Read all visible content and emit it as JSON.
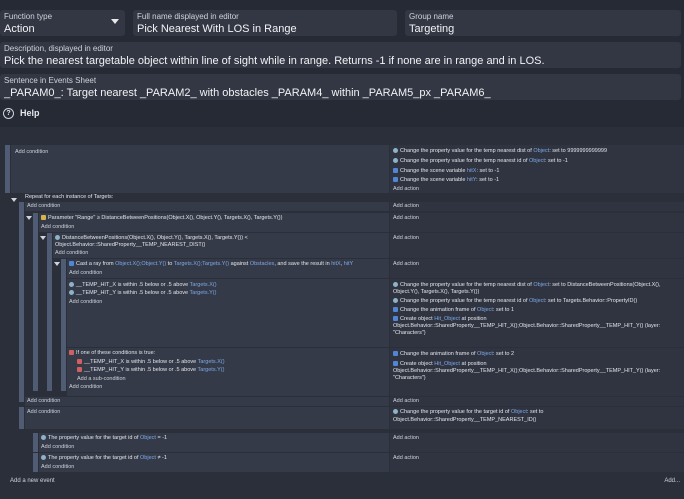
{
  "fields": {
    "function_type": {
      "label": "Function type",
      "value": "Action"
    },
    "full_name": {
      "label": "Full name displayed in editor",
      "value": "Pick Nearest With LOS in Range"
    },
    "group_name": {
      "label": "Group name",
      "value": "Targeting"
    },
    "description": {
      "label": "Description, displayed in editor",
      "value": "Pick the nearest targetable object within line of sight while in range. Returns -1 if none are in range and in LOS."
    },
    "sentence": {
      "label": "Sentence in Events Sheet",
      "value": "_PARAM0_: Target nearest _PARAM2_ with obstacles _PARAM4_ within _PARAM5_px        _PARAM6_"
    }
  },
  "help_label": "Help",
  "add_condition": "Add condition",
  "add_action": "Add action",
  "add_subcondition": "Add a sub-condition",
  "add_new_event": "Add a new event",
  "add_more": "Add...",
  "events": {
    "e1_actions": [
      {
        "text": "Change the property value for the temp nearest dist of ",
        "obj": "Object",
        "rest": ": set to  9999999999999"
      },
      {
        "text": "Change the property value for the temp nearest id of ",
        "obj": "Object",
        "rest": ": set to  -1"
      },
      {
        "text": "Change the scene variable ",
        "obj": "hitX",
        "rest": ": set to  -1"
      },
      {
        "text": "Change the scene variable ",
        "obj": "hitY",
        "rest": ": set to  -1"
      }
    ],
    "repeat_label": "Repeat for each instance of Targets:",
    "param_cond": "Parameter \"Range\"  ≥  DistanceBetweenPositions(Object.X(), Object.Y(), Targets.X(), Targets.Y())",
    "dist_cond1": "DistanceBetweenPositions(Object.X(), Object.Y(), Targets.X(), Targets.Y())  <",
    "dist_cond2": "Object.Behavior::SharedProperty__TEMP_NEAREST_DIST()",
    "raycast": {
      "a": "Cast a ray from ",
      "b": "Object.X();Object.Y()",
      "c": " to ",
      "d": "Targets.X();Targets.Y()",
      "e": " against ",
      "f": "Obstacles",
      "g": ", and save the result in ",
      "h": "hitX",
      ",": ", ",
      "i": "hitY"
    },
    "hit_cond1": "__TEMP_HIT_X  is within .5 below or .5 above ",
    "hit_cond1_obj": "Targets.X()",
    "hit_cond2": "__TEMP_HIT_Y  is within .5 below or .5 above ",
    "hit_cond2_obj": "Targets.Y()",
    "hit_actions": [
      {
        "l1": "Change the property value for the temp nearest dist of ",
        "obj": "Object",
        "l1b": ": set to  DistanceBetweenPositions(Object.X(),",
        "l2": "Object.Y(), Targets.X(), Targets.Y())"
      },
      {
        "l1": "Change the property value for the temp nearest id of ",
        "obj": "Object",
        "l1b": ": set to  Targets.Behavior::PropertyID()",
        "l2": ""
      },
      {
        "l1": "Change the animation frame of ",
        "obj": "Object",
        "l1b": ": set to  1",
        "l2": ""
      },
      {
        "l1": "Create object ",
        "obj": "Hit_Object",
        "l1b": " at position",
        "l2": "Object.Behavior::SharedProperty__TEMP_HIT_X();Object.Behavior::SharedProperty__TEMP_HIT_Y() (layer:",
        "l3": "\"Characters\")"
      }
    ],
    "or_label": "If one of these conditions is true:",
    "or_cond1": "__TEMP_HIT_X  is within .5 below or .5 above ",
    "or_cond1_obj": "Targets.X()",
    "or_cond2": "__TEMP_HIT_Y  is within .5 below or .5 above ",
    "or_cond2_obj": "Targets.Y()",
    "or_actions": [
      {
        "l1": "Change the animation frame of ",
        "obj": "Object",
        "l1b": ": set to  2"
      },
      {
        "l1": "Create object ",
        "obj": "Hit_Object",
        "l1b": " at position",
        "l2": "Object.Behavior::SharedProperty__TEMP_HIT_X();Object.Behavior::SharedProperty__TEMP_HIT_Y() (layer:",
        "l3": "\"Characters\")"
      }
    ],
    "target_action": {
      "l1": "Change the property value for the target id of ",
      "obj": "Object",
      "l1b": ": set to",
      "l2": "Object.Behavior::SharedProperty__TEMP_NEAREST_ID()"
    },
    "cond_eq": {
      "a": "The property value for the target id of ",
      "obj": "Object",
      "b": "  =  -1"
    },
    "cond_neq": {
      "a": "The property value for the target id of ",
      "obj": "Object",
      "b": "  ≠  -1"
    }
  },
  "colors": {
    "background": "#262a34",
    "field": "#323743",
    "link": "#7fa9e8",
    "bar": "#4f5c74"
  }
}
